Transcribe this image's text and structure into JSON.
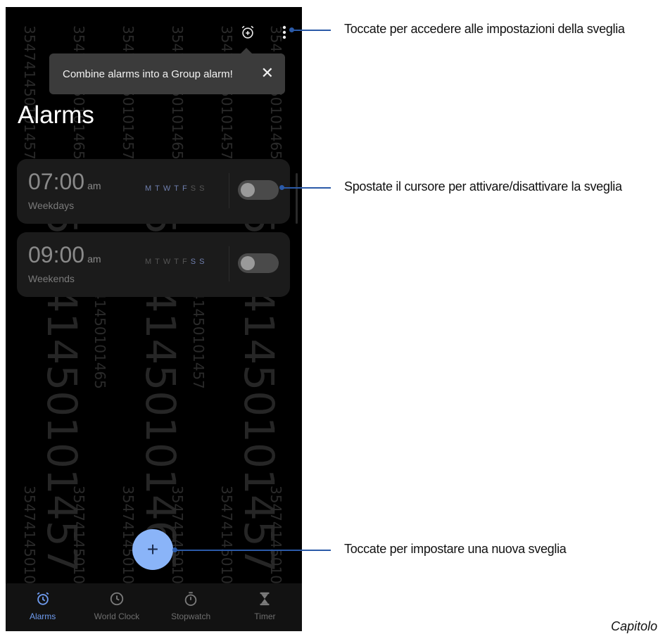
{
  "tooltip": {
    "text": "Combine alarms into a Group alarm!",
    "close_icon": "close-icon"
  },
  "page_title": "Alarms",
  "topbar": {
    "add_group_icon": "alarm-add-icon",
    "more_icon": "more-vert-icon"
  },
  "alarms": [
    {
      "time": "07:00",
      "ampm": "am",
      "label": "Weekdays",
      "days": [
        "M",
        "T",
        "W",
        "T",
        "F",
        "S",
        "S"
      ],
      "days_on": [
        true,
        true,
        true,
        true,
        true,
        false,
        false
      ],
      "enabled": false
    },
    {
      "time": "09:00",
      "ampm": "am",
      "label": "Weekends",
      "days": [
        "M",
        "T",
        "W",
        "T",
        "F",
        "S",
        "S"
      ],
      "days_on": [
        false,
        false,
        false,
        false,
        false,
        true,
        true
      ],
      "enabled": false
    }
  ],
  "fab": {
    "symbol": "+",
    "icon": "plus-icon"
  },
  "bottom_nav": [
    {
      "label": "Alarms",
      "icon": "alarm-clock-icon",
      "active": true
    },
    {
      "label": "World Clock",
      "icon": "clock-icon",
      "active": false
    },
    {
      "label": "Stopwatch",
      "icon": "stopwatch-icon",
      "active": false
    },
    {
      "label": "Timer",
      "icon": "hourglass-icon",
      "active": false
    }
  ],
  "watermark": {
    "short": "354741450101457",
    "alt": "354741450101465"
  },
  "callouts": [
    "Toccate per accedere alle impostazioni della sveglia",
    "Spostate il cursore per attivare/disattivare la sveglia",
    "Toccate per impostare una nuova sveglia"
  ],
  "footer": "Capitolo",
  "colors": {
    "accent": "#8ab4f8",
    "active_nav": "#6f9cf0",
    "callout": "#2b5aa8"
  }
}
